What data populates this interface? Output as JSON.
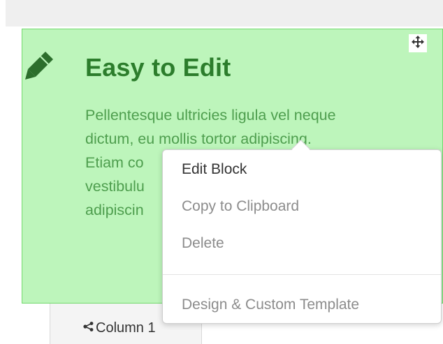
{
  "colors": {
    "block_bg": "#bdf5bb",
    "block_border": "#72d96d",
    "title": "#2c7d2c",
    "body_text": "#4e9e4e",
    "menu_active": "#333333",
    "menu_muted": "#8c8c8c"
  },
  "block": {
    "icon": "pencil-icon",
    "move_icon": "move-arrows-icon",
    "title": "Easy to Edit",
    "body_lines": [
      "Pellentesque ultricies ligula vel neque",
      "dictum, eu mollis tortor adipiscing.",
      "Etiam co",
      "vestibulu",
      "adipiscin"
    ]
  },
  "column_tab": {
    "icon": "share-icon",
    "label": "Column 1"
  },
  "context_menu": {
    "items": [
      {
        "label": "Edit Block"
      },
      {
        "label": "Copy to Clipboard"
      },
      {
        "label": "Delete"
      },
      {
        "label": "Design & Custom Template"
      }
    ]
  }
}
